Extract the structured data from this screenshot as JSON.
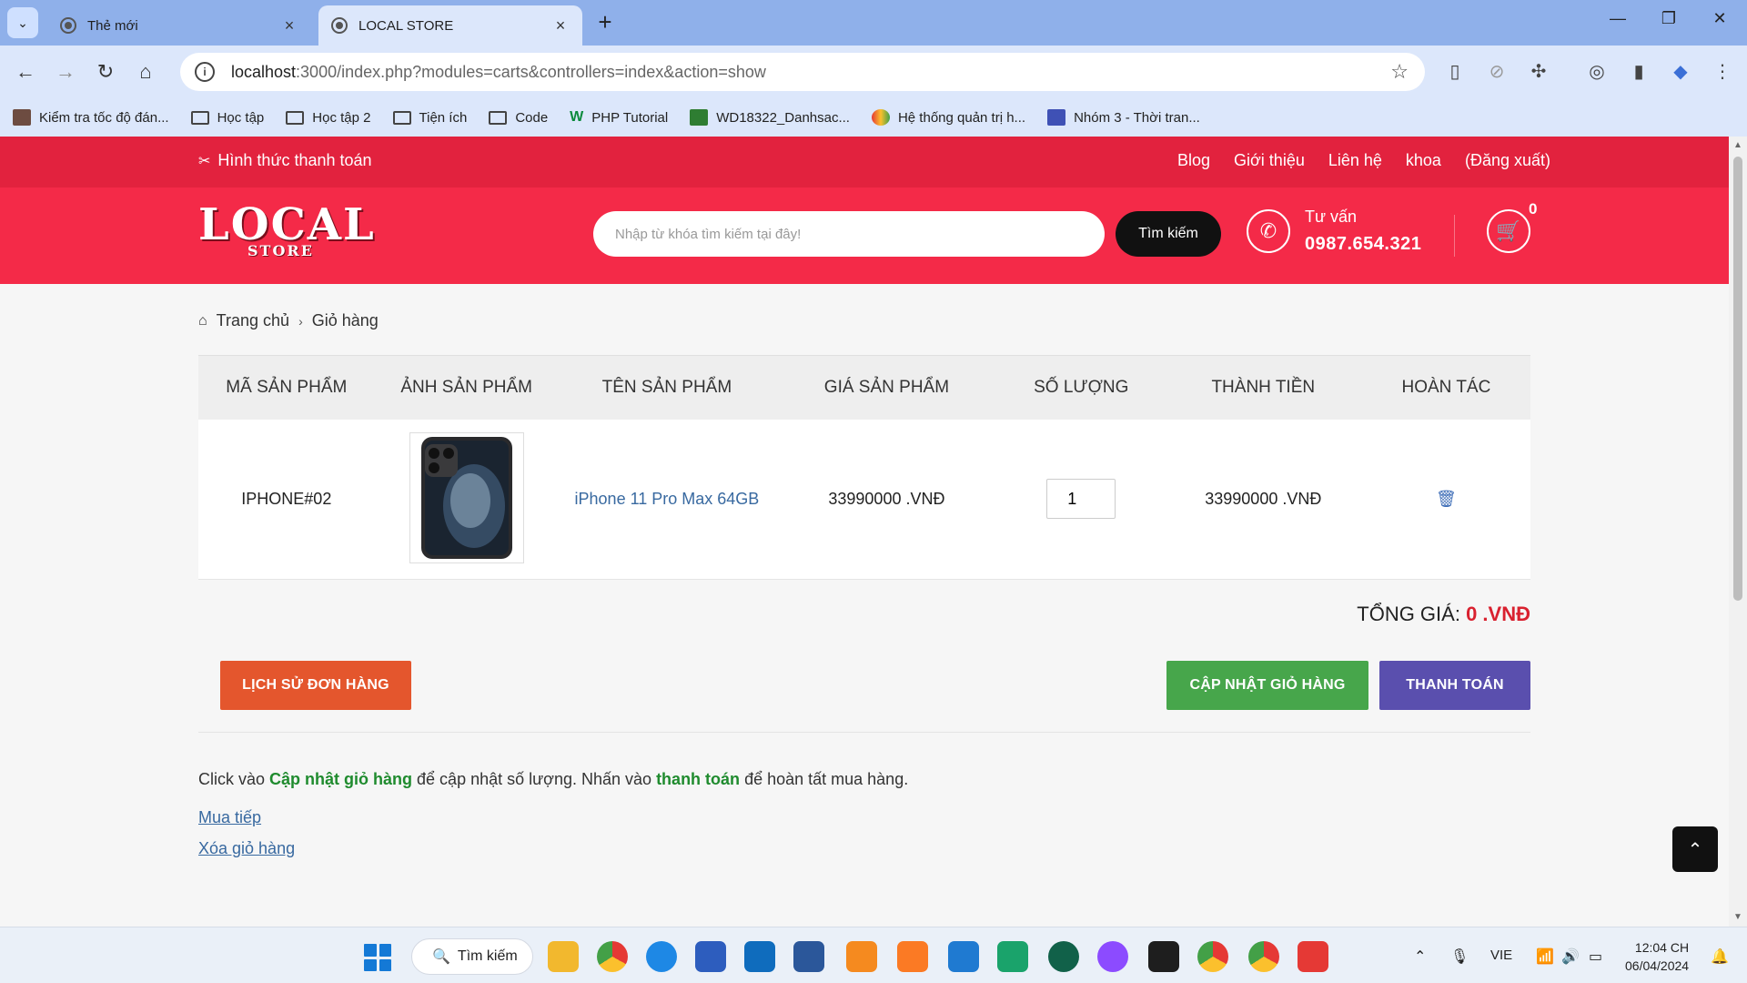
{
  "browser": {
    "tabs": [
      {
        "title": "Thẻ mới",
        "active": false
      },
      {
        "title": "LOCAL STORE",
        "active": true
      }
    ],
    "url": {
      "host": "localhost",
      "rest": ":3000/index.php?modules=carts&controllers=index&action=show"
    },
    "bookmarks": [
      {
        "label": "Kiểm tra tốc độ đán...",
        "icon": "rk"
      },
      {
        "label": "Học tập",
        "icon": "folder"
      },
      {
        "label": "Học tập 2",
        "icon": "folder"
      },
      {
        "label": "Tiện ích",
        "icon": "folder"
      },
      {
        "label": "Code",
        "icon": "folder"
      },
      {
        "label": "PHP Tutorial",
        "icon": "wv"
      },
      {
        "label": "WD18322_Danhsac...",
        "icon": "sq"
      },
      {
        "label": "Hệ thống quản trị h...",
        "icon": "ht"
      },
      {
        "label": "Nhóm 3 - Thời tran...",
        "icon": "sq2"
      }
    ]
  },
  "site": {
    "payment_methods": "Hình thức thanh toán",
    "top_nav": [
      "Blog",
      "Giới thiệu",
      "Liên hệ",
      "khoa",
      "(Đăng xuất)"
    ],
    "logo": {
      "big": "LOCAL",
      "small": "STORE"
    },
    "search": {
      "placeholder": "Nhập từ khóa tìm kiếm tại đây!",
      "button": "Tìm kiếm"
    },
    "consult": {
      "label": "Tư vấn",
      "phone": "0987.654.321"
    },
    "cart_count": "0"
  },
  "breadcrumb": {
    "home": "Trang chủ",
    "current": "Giỏ hàng"
  },
  "cart": {
    "headers": [
      "MÃ SẢN PHẨM",
      "ẢNH SẢN PHẨM",
      "TÊN SẢN PHẨM",
      "GIÁ SẢN PHẨM",
      "SỐ LƯỢNG",
      "THÀNH TIỀN",
      "HOÀN TÁC"
    ],
    "items": [
      {
        "code": "IPHONE#02",
        "name": "iPhone 11 Pro Max 64GB",
        "price": "33990000 .VNĐ",
        "qty": "1",
        "subtotal": "33990000 .VNĐ"
      }
    ],
    "total_label": "TỔNG GIÁ:",
    "total_value": "0 .VNĐ"
  },
  "actions": {
    "history": "LỊCH SỬ ĐƠN HÀNG",
    "update": "CẬP NHẬT GIỎ HÀNG",
    "checkout": "THANH TOÁN"
  },
  "note": {
    "p1": "Click vào ",
    "b1": "Cập nhật giỏ hàng",
    "p2": " để cập nhật số lượng. Nhấn vào ",
    "b2": "thanh toán",
    "p3": " để hoàn tất mua hàng."
  },
  "links": {
    "continue": "Mua tiếp",
    "clear": "Xóa giỏ hàng"
  },
  "taskbar": {
    "search": "Tìm kiếm",
    "lang": "VIE",
    "time": "12:04 CH",
    "date": "06/04/2024"
  },
  "colors": {
    "brand_red": "#f42a48",
    "strip_red": "#e2223e",
    "history_btn": "#e4562d",
    "update_btn": "#47a64b",
    "checkout_btn": "#5a4fae"
  }
}
